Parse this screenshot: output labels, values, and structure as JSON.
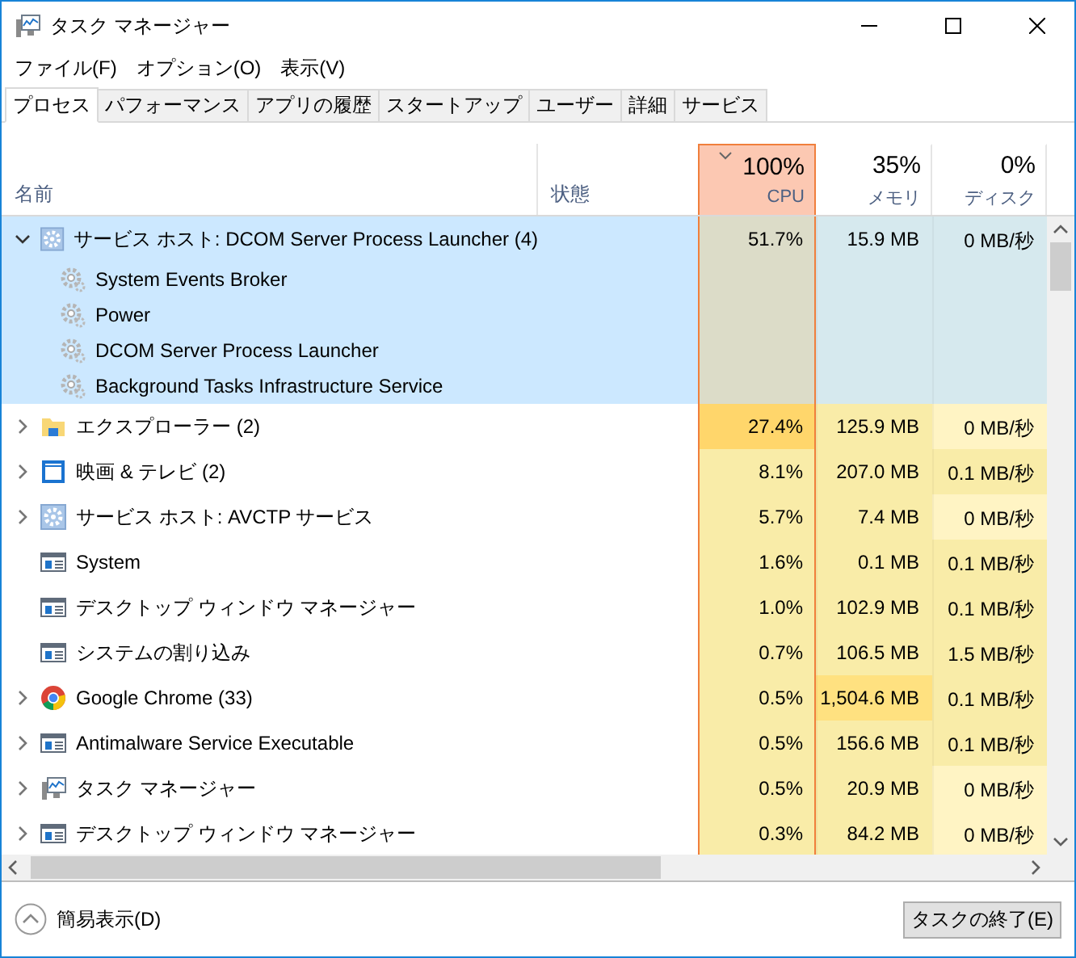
{
  "window": {
    "title": "タスク マネージャー"
  },
  "menu": [
    "ファイル(F)",
    "オプション(O)",
    "表示(V)"
  ],
  "tabs": [
    {
      "label": "プロセス",
      "selected": true
    },
    {
      "label": "パフォーマンス",
      "selected": false
    },
    {
      "label": "アプリの履歴",
      "selected": false
    },
    {
      "label": "スタートアップ",
      "selected": false
    },
    {
      "label": "ユーザー",
      "selected": false
    },
    {
      "label": "詳細",
      "selected": false
    },
    {
      "label": "サービス",
      "selected": false
    }
  ],
  "columns": {
    "name": "名前",
    "status": "状態",
    "metrics": [
      {
        "total": "100%",
        "label": "CPU",
        "sorted": true
      },
      {
        "total": "35%",
        "label": "メモリ",
        "sorted": false
      },
      {
        "total": "0%",
        "label": "ディスク",
        "sorted": false
      }
    ]
  },
  "processes": [
    {
      "name": "サービス ホスト: DCOM Server Process Launcher (4)",
      "kind": "gear",
      "expandable": true,
      "expanded": true,
      "selected": true,
      "cpu": {
        "text": "51.7%"
      },
      "memory": {
        "text": "15.9 MB"
      },
      "disk": {
        "text": "0 MB/秒"
      },
      "children": [
        {
          "name": "System Events Broker"
        },
        {
          "name": "Power"
        },
        {
          "name": "DCOM Server Process Launcher"
        },
        {
          "name": "Background Tasks Infrastructure Service"
        }
      ]
    },
    {
      "name": "エクスプローラー (2)",
      "kind": "folder",
      "expandable": true,
      "expanded": false,
      "selected": false,
      "cpu": {
        "text": "27.4%",
        "color": "#ffd66b"
      },
      "memory": {
        "text": "125.9 MB",
        "color": "#f9eca8"
      },
      "disk": {
        "text": "0 MB/秒",
        "color": "#fff4c4"
      }
    },
    {
      "name": "映画 & テレビ (2)",
      "kind": "film",
      "expandable": true,
      "expanded": false,
      "selected": false,
      "cpu": {
        "text": "8.1%",
        "color": "#f9eca8"
      },
      "memory": {
        "text": "207.0 MB",
        "color": "#f9eca8"
      },
      "disk": {
        "text": "0.1 MB/秒",
        "color": "#f9eca8"
      }
    },
    {
      "name": "サービス ホスト: AVCTP サービス",
      "kind": "gear",
      "expandable": true,
      "expanded": false,
      "selected": false,
      "cpu": {
        "text": "5.7%",
        "color": "#f9eca8"
      },
      "memory": {
        "text": "7.4 MB",
        "color": "#f9eca8"
      },
      "disk": {
        "text": "0 MB/秒",
        "color": "#fff4c4"
      }
    },
    {
      "name": "System",
      "kind": "window",
      "expandable": false,
      "selected": false,
      "cpu": {
        "text": "1.6%",
        "color": "#f9eca8"
      },
      "memory": {
        "text": "0.1 MB",
        "color": "#f9eca8"
      },
      "disk": {
        "text": "0.1 MB/秒",
        "color": "#f9eca8"
      }
    },
    {
      "name": "デスクトップ ウィンドウ マネージャー",
      "kind": "window",
      "expandable": false,
      "selected": false,
      "cpu": {
        "text": "1.0%",
        "color": "#f9eca8"
      },
      "memory": {
        "text": "102.9 MB",
        "color": "#f9eca8"
      },
      "disk": {
        "text": "0.1 MB/秒",
        "color": "#f9eca8"
      }
    },
    {
      "name": "システムの割り込み",
      "kind": "window",
      "expandable": false,
      "selected": false,
      "cpu": {
        "text": "0.7%",
        "color": "#f9eca8"
      },
      "memory": {
        "text": "106.5 MB",
        "color": "#f9eca8"
      },
      "disk": {
        "text": "1.5 MB/秒",
        "color": "#f9eca8"
      }
    },
    {
      "name": "Google Chrome (33)",
      "kind": "browser",
      "expandable": true,
      "expanded": false,
      "selected": false,
      "cpu": {
        "text": "0.5%",
        "color": "#f9eca8"
      },
      "memory": {
        "text": "1,504.6 MB",
        "color": "#ffe180"
      },
      "disk": {
        "text": "0.1 MB/秒",
        "color": "#f9eca8"
      }
    },
    {
      "name": "Antimalware Service Executable",
      "kind": "window",
      "expandable": true,
      "expanded": false,
      "selected": false,
      "cpu": {
        "text": "0.5%",
        "color": "#f9eca8"
      },
      "memory": {
        "text": "156.6 MB",
        "color": "#f9eca8"
      },
      "disk": {
        "text": "0.1 MB/秒",
        "color": "#f9eca8"
      }
    },
    {
      "name": "タスク マネージャー",
      "kind": "monitor",
      "expandable": true,
      "expanded": false,
      "selected": false,
      "cpu": {
        "text": "0.5%",
        "color": "#f9eca8"
      },
      "memory": {
        "text": "20.9 MB",
        "color": "#f9eca8"
      },
      "disk": {
        "text": "0 MB/秒",
        "color": "#fff4c4"
      }
    },
    {
      "name": "デスクトップ ウィンドウ マネージャー",
      "kind": "window",
      "expandable": true,
      "expanded": false,
      "selected": false,
      "cpu": {
        "text": "0.3%",
        "color": "#f9eca8"
      },
      "memory": {
        "text": "84.2 MB",
        "color": "#f9eca8"
      },
      "disk": {
        "text": "0 MB/秒",
        "color": "#fff4c4"
      }
    }
  ],
  "footer": {
    "fewer_details": "簡易表示(D)",
    "end_task": "タスクの終了(E)"
  }
}
